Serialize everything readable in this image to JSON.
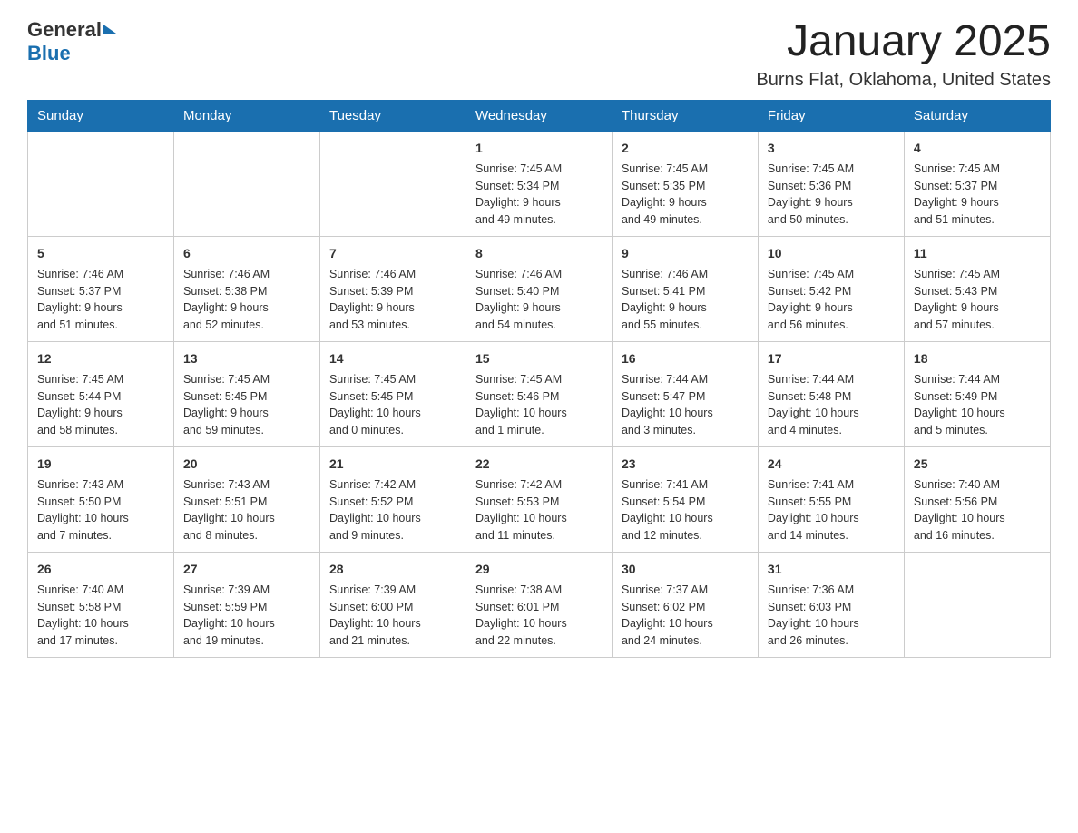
{
  "header": {
    "logo_general": "General",
    "logo_blue": "Blue",
    "month_title": "January 2025",
    "location": "Burns Flat, Oklahoma, United States"
  },
  "days_of_week": [
    "Sunday",
    "Monday",
    "Tuesday",
    "Wednesday",
    "Thursday",
    "Friday",
    "Saturday"
  ],
  "weeks": [
    {
      "days": [
        {
          "num": "",
          "info": ""
        },
        {
          "num": "",
          "info": ""
        },
        {
          "num": "",
          "info": ""
        },
        {
          "num": "1",
          "info": "Sunrise: 7:45 AM\nSunset: 5:34 PM\nDaylight: 9 hours\nand 49 minutes."
        },
        {
          "num": "2",
          "info": "Sunrise: 7:45 AM\nSunset: 5:35 PM\nDaylight: 9 hours\nand 49 minutes."
        },
        {
          "num": "3",
          "info": "Sunrise: 7:45 AM\nSunset: 5:36 PM\nDaylight: 9 hours\nand 50 minutes."
        },
        {
          "num": "4",
          "info": "Sunrise: 7:45 AM\nSunset: 5:37 PM\nDaylight: 9 hours\nand 51 minutes."
        }
      ]
    },
    {
      "days": [
        {
          "num": "5",
          "info": "Sunrise: 7:46 AM\nSunset: 5:37 PM\nDaylight: 9 hours\nand 51 minutes."
        },
        {
          "num": "6",
          "info": "Sunrise: 7:46 AM\nSunset: 5:38 PM\nDaylight: 9 hours\nand 52 minutes."
        },
        {
          "num": "7",
          "info": "Sunrise: 7:46 AM\nSunset: 5:39 PM\nDaylight: 9 hours\nand 53 minutes."
        },
        {
          "num": "8",
          "info": "Sunrise: 7:46 AM\nSunset: 5:40 PM\nDaylight: 9 hours\nand 54 minutes."
        },
        {
          "num": "9",
          "info": "Sunrise: 7:46 AM\nSunset: 5:41 PM\nDaylight: 9 hours\nand 55 minutes."
        },
        {
          "num": "10",
          "info": "Sunrise: 7:45 AM\nSunset: 5:42 PM\nDaylight: 9 hours\nand 56 minutes."
        },
        {
          "num": "11",
          "info": "Sunrise: 7:45 AM\nSunset: 5:43 PM\nDaylight: 9 hours\nand 57 minutes."
        }
      ]
    },
    {
      "days": [
        {
          "num": "12",
          "info": "Sunrise: 7:45 AM\nSunset: 5:44 PM\nDaylight: 9 hours\nand 58 minutes."
        },
        {
          "num": "13",
          "info": "Sunrise: 7:45 AM\nSunset: 5:45 PM\nDaylight: 9 hours\nand 59 minutes."
        },
        {
          "num": "14",
          "info": "Sunrise: 7:45 AM\nSunset: 5:45 PM\nDaylight: 10 hours\nand 0 minutes."
        },
        {
          "num": "15",
          "info": "Sunrise: 7:45 AM\nSunset: 5:46 PM\nDaylight: 10 hours\nand 1 minute."
        },
        {
          "num": "16",
          "info": "Sunrise: 7:44 AM\nSunset: 5:47 PM\nDaylight: 10 hours\nand 3 minutes."
        },
        {
          "num": "17",
          "info": "Sunrise: 7:44 AM\nSunset: 5:48 PM\nDaylight: 10 hours\nand 4 minutes."
        },
        {
          "num": "18",
          "info": "Sunrise: 7:44 AM\nSunset: 5:49 PM\nDaylight: 10 hours\nand 5 minutes."
        }
      ]
    },
    {
      "days": [
        {
          "num": "19",
          "info": "Sunrise: 7:43 AM\nSunset: 5:50 PM\nDaylight: 10 hours\nand 7 minutes."
        },
        {
          "num": "20",
          "info": "Sunrise: 7:43 AM\nSunset: 5:51 PM\nDaylight: 10 hours\nand 8 minutes."
        },
        {
          "num": "21",
          "info": "Sunrise: 7:42 AM\nSunset: 5:52 PM\nDaylight: 10 hours\nand 9 minutes."
        },
        {
          "num": "22",
          "info": "Sunrise: 7:42 AM\nSunset: 5:53 PM\nDaylight: 10 hours\nand 11 minutes."
        },
        {
          "num": "23",
          "info": "Sunrise: 7:41 AM\nSunset: 5:54 PM\nDaylight: 10 hours\nand 12 minutes."
        },
        {
          "num": "24",
          "info": "Sunrise: 7:41 AM\nSunset: 5:55 PM\nDaylight: 10 hours\nand 14 minutes."
        },
        {
          "num": "25",
          "info": "Sunrise: 7:40 AM\nSunset: 5:56 PM\nDaylight: 10 hours\nand 16 minutes."
        }
      ]
    },
    {
      "days": [
        {
          "num": "26",
          "info": "Sunrise: 7:40 AM\nSunset: 5:58 PM\nDaylight: 10 hours\nand 17 minutes."
        },
        {
          "num": "27",
          "info": "Sunrise: 7:39 AM\nSunset: 5:59 PM\nDaylight: 10 hours\nand 19 minutes."
        },
        {
          "num": "28",
          "info": "Sunrise: 7:39 AM\nSunset: 6:00 PM\nDaylight: 10 hours\nand 21 minutes."
        },
        {
          "num": "29",
          "info": "Sunrise: 7:38 AM\nSunset: 6:01 PM\nDaylight: 10 hours\nand 22 minutes."
        },
        {
          "num": "30",
          "info": "Sunrise: 7:37 AM\nSunset: 6:02 PM\nDaylight: 10 hours\nand 24 minutes."
        },
        {
          "num": "31",
          "info": "Sunrise: 7:36 AM\nSunset: 6:03 PM\nDaylight: 10 hours\nand 26 minutes."
        },
        {
          "num": "",
          "info": ""
        }
      ]
    }
  ]
}
